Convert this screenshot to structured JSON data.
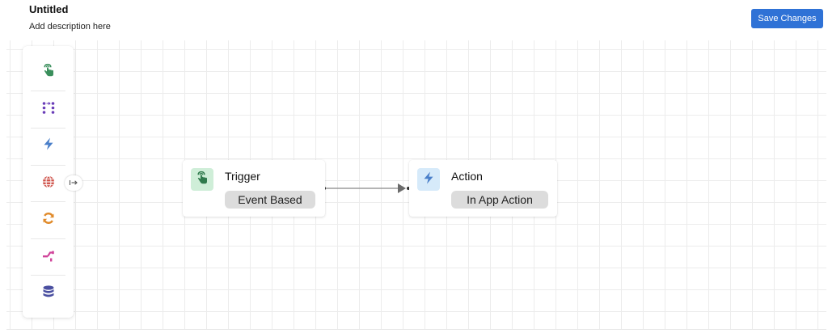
{
  "header": {
    "title": "Untitled",
    "description": "Add description here",
    "save_label": "Save Changes"
  },
  "palette": {
    "items": [
      {
        "icon": "hand-tap-icon",
        "color": "#3a8f5c"
      },
      {
        "icon": "nodes-grid-icon",
        "color": "#6a3db8"
      },
      {
        "icon": "lightning-icon",
        "color": "#4a7fc9"
      },
      {
        "icon": "globe-icon",
        "color": "#d0574f"
      },
      {
        "icon": "refresh-icon",
        "color": "#e08a2a"
      },
      {
        "icon": "branch-icon",
        "color": "#d0449a"
      },
      {
        "icon": "database-icon",
        "color": "#4a4fa0"
      }
    ]
  },
  "nodes": {
    "trigger": {
      "title": "Trigger",
      "pill": "Event Based",
      "icon": "hand-tap-icon",
      "icon_bg": "#cfeed8"
    },
    "action": {
      "title": "Action",
      "pill": "In App Action",
      "icon": "lightning-icon",
      "icon_bg": "#d6eafa"
    }
  }
}
